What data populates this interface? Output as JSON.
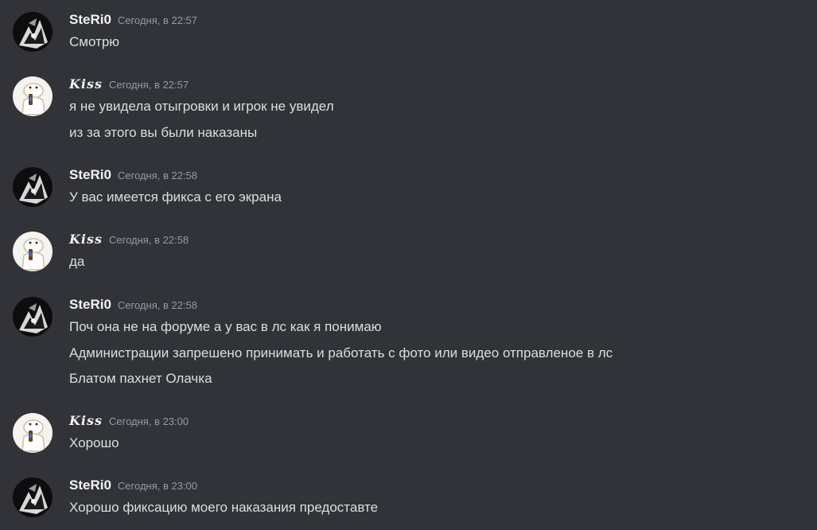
{
  "messages": [
    {
      "author": "SteRi0",
      "avatar_icon": "dark-anime-avatar-icon",
      "timestamp": "Сегодня, в 22:57",
      "lines": [
        "Смотрю"
      ]
    },
    {
      "author": "𝑲𝒊𝒔𝒔",
      "avatar_icon": "white-character-avatar-icon",
      "timestamp": "Сегодня, в 22:57",
      "lines": [
        "я не увидела отыгровки и игрок не увидел",
        "из за этого вы были наказаны"
      ]
    },
    {
      "author": "SteRi0",
      "avatar_icon": "dark-anime-avatar-icon",
      "timestamp": "Сегодня, в 22:58",
      "lines": [
        "У вас имеется фикса с его экрана"
      ]
    },
    {
      "author": "𝑲𝒊𝒔𝒔",
      "avatar_icon": "white-character-avatar-icon",
      "timestamp": "Сегодня, в 22:58",
      "lines": [
        "да"
      ]
    },
    {
      "author": "SteRi0",
      "avatar_icon": "dark-anime-avatar-icon",
      "timestamp": "Сегодня, в 22:58",
      "lines": [
        "Поч она не на форуме а у вас в лс как я понимаю",
        "Администрации запрешено принимать и работать с фото или видео отправленое в лс",
        "Блатом пахнет Олачка"
      ]
    },
    {
      "author": "𝑲𝒊𝒔𝒔",
      "avatar_icon": "white-character-avatar-icon",
      "timestamp": "Сегодня, в 23:00",
      "lines": [
        "Хорошо"
      ]
    },
    {
      "author": "SteRi0",
      "avatar_icon": "dark-anime-avatar-icon",
      "timestamp": "Сегодня, в 23:00",
      "lines": [
        "Хорошо фиксацию моего наказания предоставте"
      ]
    }
  ]
}
